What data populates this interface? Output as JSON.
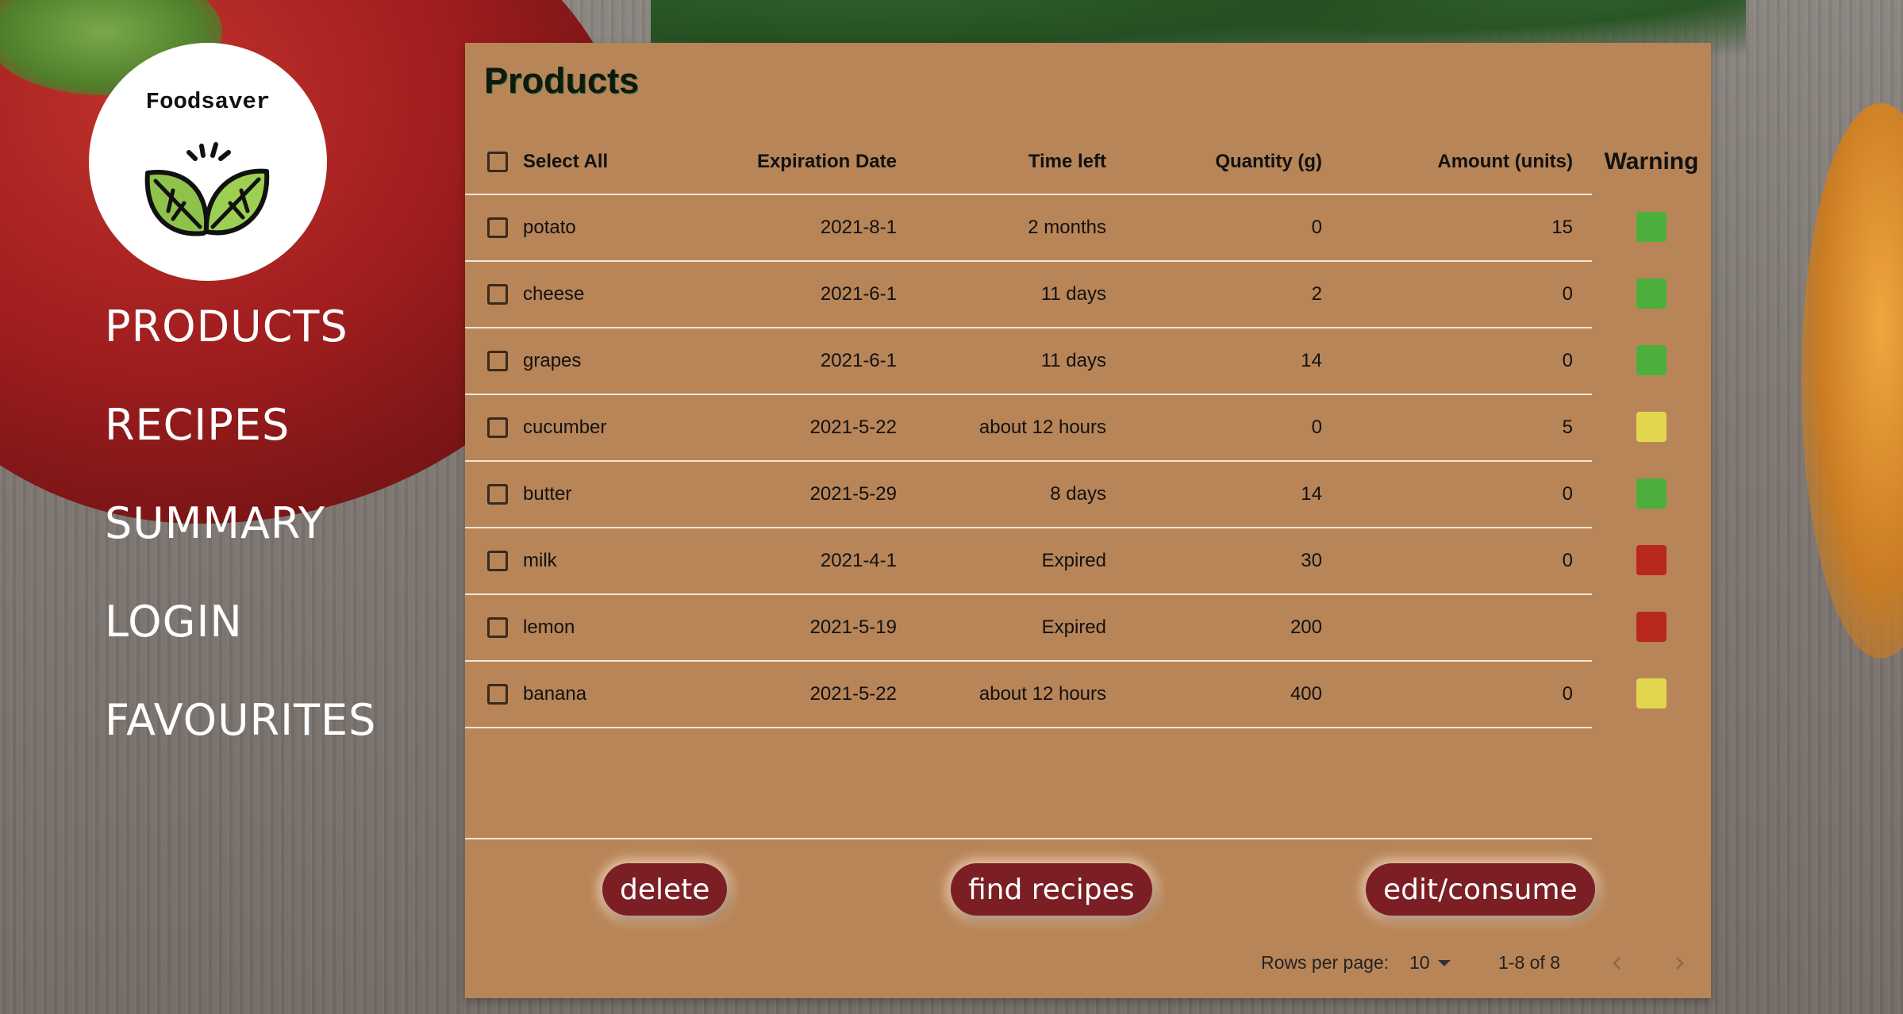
{
  "app": {
    "logo_text": "Foodsaver"
  },
  "nav": {
    "items": [
      {
        "label": "PRODUCTS"
      },
      {
        "label": "RECIPES"
      },
      {
        "label": "SUMMARY"
      },
      {
        "label": "LOGIN"
      },
      {
        "label": "FAVOURITES"
      }
    ]
  },
  "panel": {
    "title": "Products"
  },
  "table": {
    "headers": {
      "select_all": "Select All",
      "expiration": "Expiration Date",
      "time_left": "Time left",
      "quantity": "Quantity (g)",
      "amount": "Amount (units)",
      "warning": "Warning"
    },
    "rows": [
      {
        "name": "potato",
        "expiration": "2021-8-1",
        "time_left": "2 months",
        "quantity": "0",
        "amount": "15",
        "warning": "green"
      },
      {
        "name": "cheese",
        "expiration": "2021-6-1",
        "time_left": "11 days",
        "quantity": "2",
        "amount": "0",
        "warning": "green"
      },
      {
        "name": "grapes",
        "expiration": "2021-6-1",
        "time_left": "11 days",
        "quantity": "14",
        "amount": "0",
        "warning": "green"
      },
      {
        "name": "cucumber",
        "expiration": "2021-5-22",
        "time_left": "about 12 hours",
        "quantity": "0",
        "amount": "5",
        "warning": "yellow"
      },
      {
        "name": "butter",
        "expiration": "2021-5-29",
        "time_left": "8 days",
        "quantity": "14",
        "amount": "0",
        "warning": "green"
      },
      {
        "name": "milk",
        "expiration": "2021-4-1",
        "time_left": "Expired",
        "quantity": "30",
        "amount": "0",
        "warning": "red"
      },
      {
        "name": "lemon",
        "expiration": "2021-5-19",
        "time_left": "Expired",
        "quantity": "200",
        "amount": "",
        "warning": "red"
      },
      {
        "name": "banana",
        "expiration": "2021-5-22",
        "time_left": "about 12 hours",
        "quantity": "400",
        "amount": "0",
        "warning": "yellow"
      }
    ]
  },
  "warning_colors": {
    "green": "#4caf3c",
    "yellow": "#e3d64f",
    "red": "#b8281f"
  },
  "buttons": {
    "delete": "delete",
    "find_recipes": "find recipes",
    "edit_consume": "edit/consume"
  },
  "pagination": {
    "rows_per_page_label": "Rows per page:",
    "rows_per_page_value": "10",
    "range": "1-8 of 8",
    "prev_icon": "chevron-left-icon",
    "next_icon": "chevron-right-icon"
  }
}
